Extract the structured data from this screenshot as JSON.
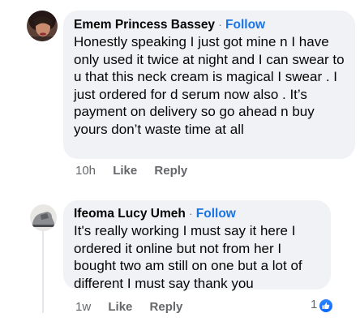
{
  "comments": [
    {
      "author": "Emem Princess Bassey",
      "separator": "·",
      "follow_label": "Follow",
      "text": "Honestly speaking I just got mine n I have only used it twice at night and I can swear to u that this neck cream is magical I swear . I just ordered for d serum now also . It’s payment on delivery so go ahead n buy yours don’t waste time at all",
      "time": "10h",
      "like_label": "Like",
      "reply_label": "Reply"
    },
    {
      "author": "Ifeoma Lucy Umeh",
      "separator": "·",
      "follow_label": "Follow",
      "text": "It's really working I must say it here I ordered it online but not from her I bought two am still on one but a lot of different I must say thank you",
      "time": "1w",
      "like_label": "Like",
      "reply_label": "Reply",
      "reaction_count": "1",
      "reaction_icon": "thumbs-up-icon"
    }
  ],
  "colors": {
    "bubble": "#f0f2f5",
    "follow": "#1b74e4",
    "meta": "#65676b"
  }
}
